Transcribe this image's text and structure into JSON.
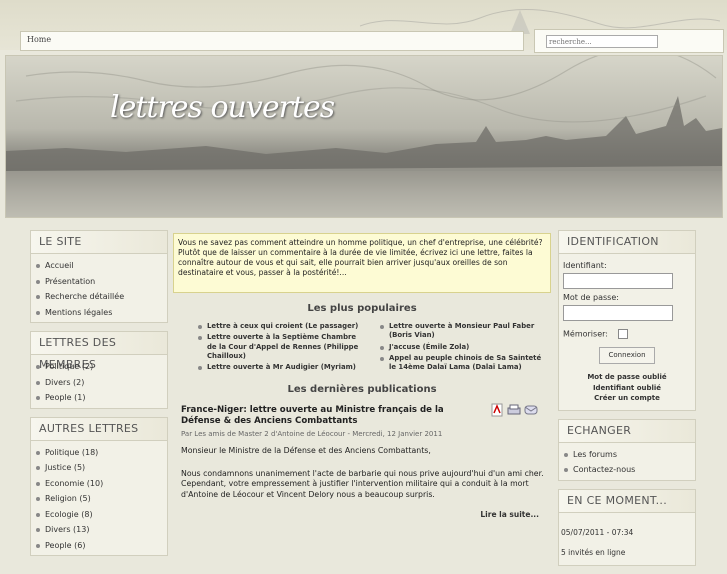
{
  "breadcrumb": {
    "home": "Home"
  },
  "search": {
    "placeholder": "recherche..."
  },
  "banner": {
    "logo": "lettres ouvertes"
  },
  "left": {
    "site": {
      "title": "LE SITE",
      "items": [
        "Accueil",
        "Présentation",
        "Recherche détaillée",
        "Mentions légales"
      ]
    },
    "members": {
      "title": "LETTRES DES MEMBRES",
      "items": [
        "Politique (2)",
        "Divers (2)",
        "People (1)"
      ]
    },
    "others": {
      "title": "AUTRES LETTRES",
      "items": [
        "Politique (18)",
        "Justice (5)",
        "Economie (10)",
        "Religion (5)",
        "Ecologie (8)",
        "Divers (13)",
        "People (6)"
      ]
    }
  },
  "main": {
    "intro": "Vous ne savez pas comment atteindre un homme politique, un chef d'entreprise, une célébrité? Plutôt que de laisser un commentaire à la durée de vie limitée, écrivez ici une lettre, faites la connaître autour de vous et qui sait, elle pourrait bien arriver jusqu'aux oreilles de son destinataire et vous, passer à la postérité!...",
    "popular_title": "Les plus populaires",
    "popular_left": [
      "Lettre à ceux qui croient (Le passager)",
      "Lettre ouverte à la Septième Chambre de la Cour d'Appel de Rennes (Philippe Chailloux)",
      "Lettre ouverte à Mr Audigier (Myriam)"
    ],
    "popular_right": [
      "Lettre ouverte à Monsieur Paul Faber (Boris Vian)",
      "J'accuse (Émile Zola)",
      "Appel au peuple chinois de Sa Sainteté le 14ème Dalaï Lama (Dalaï Lama)"
    ],
    "latest_title": "Les dernières publications",
    "article": {
      "title": "France-Niger: lettre ouverte au Ministre français de la Défense & des Anciens Combattants",
      "meta": "Par Les amis de Master 2 d'Antoine de Léocour - Mercredi, 12 Janvier 2011",
      "p1": "Monsieur le Ministre de la Défense et des Anciens Combattants,",
      "p2": "Nous condamnons unanimement l'acte de barbarie qui nous prive aujourd'hui d'un ami cher. Cependant, votre empressement à justifier l'intervention militaire qui a conduit à la mort d'Antoine de Léocour et Vincent Delory nous a beaucoup surpris.",
      "more": "Lire la suite..."
    }
  },
  "right": {
    "login": {
      "title": "IDENTIFICATION",
      "id_label": "Identifiant:",
      "pw_label": "Mot de passe:",
      "remember": "Mémoriser:",
      "button": "Connexion",
      "forgot_pw": "Mot de passe oublié",
      "forgot_id": "Identifiant oublié",
      "register": "Créer un compte"
    },
    "exchange": {
      "title": "ECHANGER",
      "items": [
        "Les forums",
        "Contactez-nous"
      ]
    },
    "moment": {
      "title": "EN CE MOMENT...",
      "date": "05/07/2011 - 07:34",
      "guests": "5 invités en ligne"
    }
  },
  "colors": {
    "page_bg": "#e9e8dc",
    "box_bg": "#f2f1e7",
    "intro_bg": "#fdfbd4"
  }
}
